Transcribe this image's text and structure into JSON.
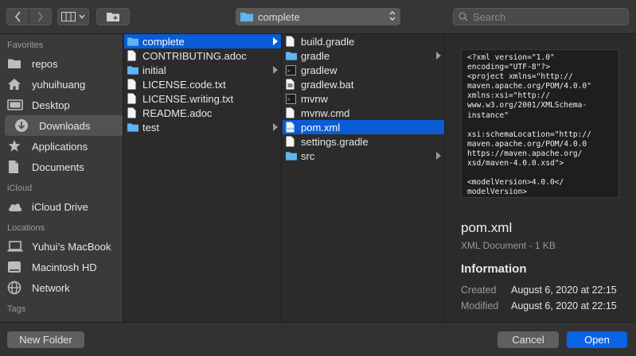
{
  "toolbar": {
    "path_label": "complete",
    "search_placeholder": "Search"
  },
  "sidebar": {
    "favorites_header": "Favorites",
    "favorites": [
      {
        "label": "repos",
        "icon": "folder-icon"
      },
      {
        "label": "yuhuihuang",
        "icon": "home-icon"
      },
      {
        "label": "Desktop",
        "icon": "desktop-icon"
      },
      {
        "label": "Downloads",
        "icon": "downloads-icon",
        "selected": true
      },
      {
        "label": "Applications",
        "icon": "applications-icon"
      },
      {
        "label": "Documents",
        "icon": "documents-icon"
      }
    ],
    "icloud_header": "iCloud",
    "icloud": [
      {
        "label": "iCloud Drive",
        "icon": "cloud-icon"
      }
    ],
    "locations_header": "Locations",
    "locations": [
      {
        "label": "Yuhui’s MacBook",
        "icon": "laptop-icon"
      },
      {
        "label": "Macintosh HD",
        "icon": "harddisk-icon"
      },
      {
        "label": "Network",
        "icon": "network-icon"
      }
    ],
    "tags_header": "Tags"
  },
  "column1": [
    {
      "name": "complete",
      "type": "folder",
      "selected": true
    },
    {
      "name": "CONTRIBUTING.adoc",
      "type": "file"
    },
    {
      "name": "initial",
      "type": "folder"
    },
    {
      "name": "LICENSE.code.txt",
      "type": "file"
    },
    {
      "name": "LICENSE.writing.txt",
      "type": "file"
    },
    {
      "name": "README.adoc",
      "type": "file"
    },
    {
      "name": "test",
      "type": "folder"
    }
  ],
  "column2": [
    {
      "name": "build.gradle",
      "type": "file"
    },
    {
      "name": "gradle",
      "type": "folder"
    },
    {
      "name": "gradlew",
      "type": "exec"
    },
    {
      "name": "gradlew.bat",
      "type": "file"
    },
    {
      "name": "mvnw",
      "type": "exec"
    },
    {
      "name": "mvnw.cmd",
      "type": "file"
    },
    {
      "name": "pom.xml",
      "type": "xml",
      "selected": true
    },
    {
      "name": "settings.gradle",
      "type": "file"
    },
    {
      "name": "src",
      "type": "folder"
    }
  ],
  "preview": {
    "content": "<?xml version=\"1.0\"\nencoding=\"UTF-8\"?>\n<project xmlns=\"http://\nmaven.apache.org/POM/4.0.0\"\nxmlns:xsi=\"http://\nwww.w3.org/2001/XMLSchema-\ninstance\"\n\nxsi:schemaLocation=\"http://\nmaven.apache.org/POM/4.0.0\nhttps://maven.apache.org/\nxsd/maven-4.0.0.xsd\">\n\n<modelVersion>4.0.0</\nmodelVersion>",
    "file_name": "pom.xml",
    "file_kind": "XML Document - 1 KB",
    "info_header": "Information",
    "created_label": "Created",
    "created_value": "August 6, 2020 at 22:15",
    "modified_label": "Modified",
    "modified_value": "August 6, 2020 at 22:15"
  },
  "buttons": {
    "new_folder": "New Folder",
    "cancel": "Cancel",
    "open": "Open"
  },
  "colors": {
    "selection": "#0a5cd6",
    "folder": "#5fb4f0",
    "open_button": "#0b63e6"
  }
}
